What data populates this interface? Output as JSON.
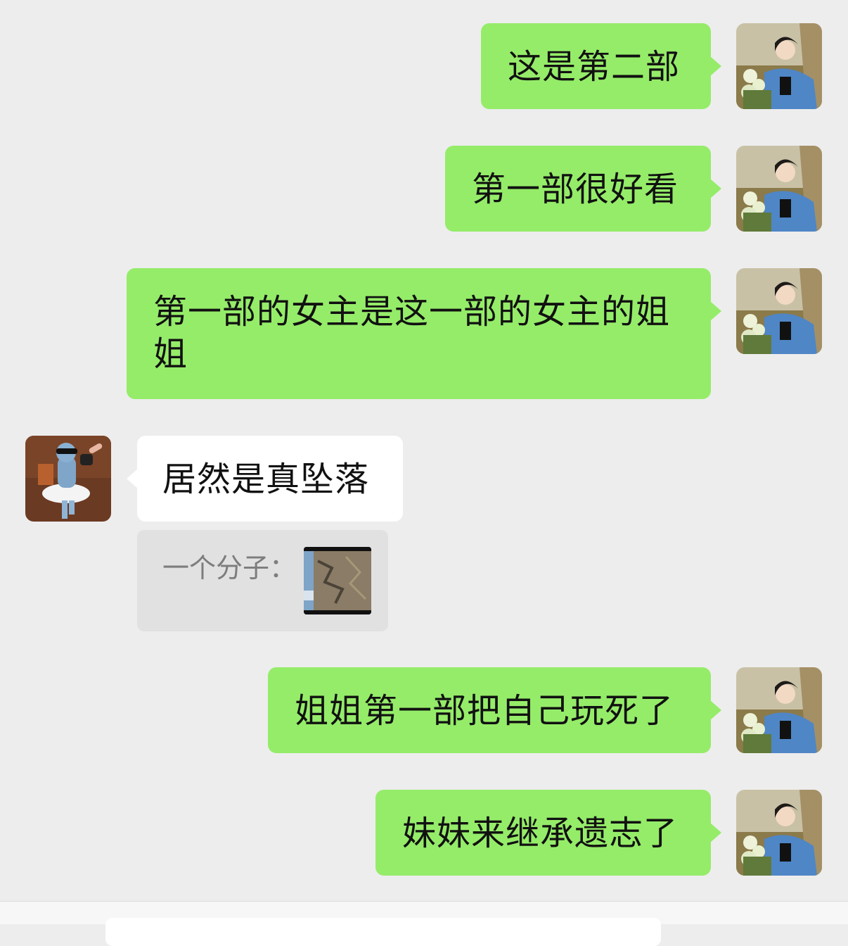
{
  "messages": [
    {
      "side": "me",
      "text": "这是第二部"
    },
    {
      "side": "me",
      "text": "第一部很好看"
    },
    {
      "side": "me",
      "text": "第一部的女主是这一部的女主的姐姐"
    },
    {
      "side": "other",
      "text": "居然是真坠落",
      "quote_text": "一个分子："
    },
    {
      "side": "me",
      "text": "姐姐第一部把自己玩死了"
    },
    {
      "side": "me",
      "text": "妹妹来继承遗志了"
    }
  ],
  "colors": {
    "background": "#ededed",
    "my_bubble": "#95ec69",
    "other_bubble": "#ffffff",
    "quote_bg": "#e1e1e1",
    "quote_text": "#7d7d7d"
  },
  "icons": {
    "my_avatar": "woman-with-flowers-avatar",
    "other_avatar": "ballerina-figurine-avatar",
    "quote_thumbnail": "image-thumbnail"
  }
}
